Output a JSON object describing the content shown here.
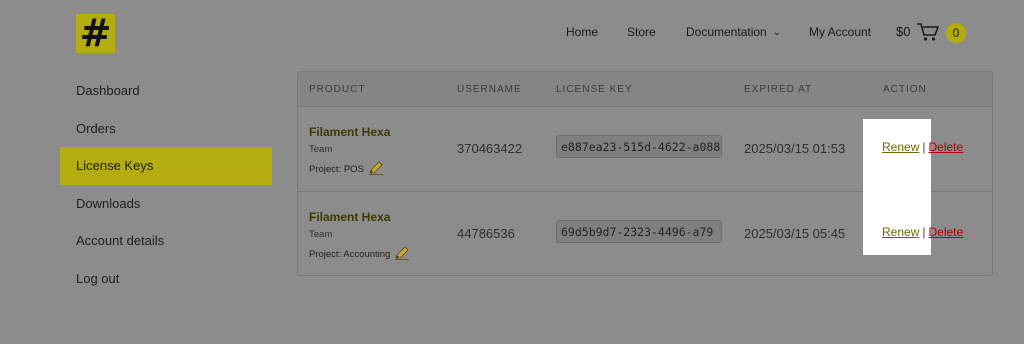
{
  "logo": {
    "glyph": "#"
  },
  "topnav": {
    "home": "Home",
    "store": "Store",
    "documentation": "Documentation",
    "account": "My Account"
  },
  "cart": {
    "total": "$0",
    "count": "0"
  },
  "sidebar": {
    "items": [
      {
        "label": "Dashboard"
      },
      {
        "label": "Orders"
      },
      {
        "label": "License Keys"
      },
      {
        "label": "Downloads"
      },
      {
        "label": "Account details"
      },
      {
        "label": "Log out"
      }
    ]
  },
  "table": {
    "headers": {
      "product": "PRODUCT",
      "username": "USERNAME",
      "license_key": "LICENSE KEY",
      "expired_at": "EXPIRED AT",
      "action": "ACTION"
    },
    "rows": [
      {
        "product": "Filament Hexa",
        "plan": "Team",
        "project": "Project: POS",
        "username": "370463422",
        "license_key": "e887ea23-515d-4622-a088",
        "expired_at": "2025/03/15 01:53",
        "renew": "Renew",
        "separator": "|",
        "delete": "Delete"
      },
      {
        "product": "Filament Hexa",
        "plan": "Team",
        "project": "Project: Accounting",
        "username": "44786536",
        "license_key": "69d5b9d7-2323-4496-a79",
        "expired_at": "2025/03/15 05:45",
        "renew": "Renew",
        "separator": "|",
        "delete": "Delete"
      }
    ]
  },
  "colors": {
    "accent": "#b3ad10",
    "overlay": "#8c8c8c",
    "delete": "#b10000"
  }
}
